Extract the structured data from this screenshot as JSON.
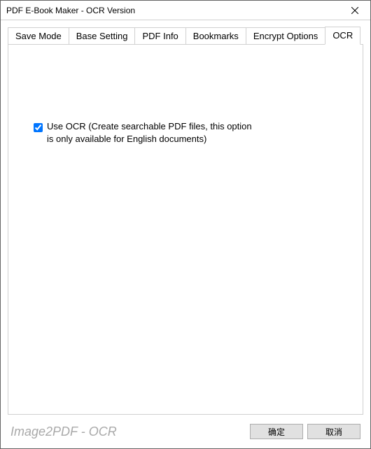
{
  "window": {
    "title": "PDF E-Book Maker - OCR Version"
  },
  "tabs": {
    "items": [
      {
        "label": "Save Mode"
      },
      {
        "label": "Base Setting"
      },
      {
        "label": "PDF Info"
      },
      {
        "label": "Bookmarks"
      },
      {
        "label": "Encrypt Options"
      },
      {
        "label": "OCR"
      }
    ],
    "active_index": 5
  },
  "ocr_panel": {
    "use_ocr_checked": true,
    "use_ocr_label": "Use OCR (Create searchable PDF files, this option is only available for English documents)"
  },
  "footer": {
    "brand": "Image2PDF - OCR",
    "ok_label": "确定",
    "cancel_label": "取消"
  }
}
